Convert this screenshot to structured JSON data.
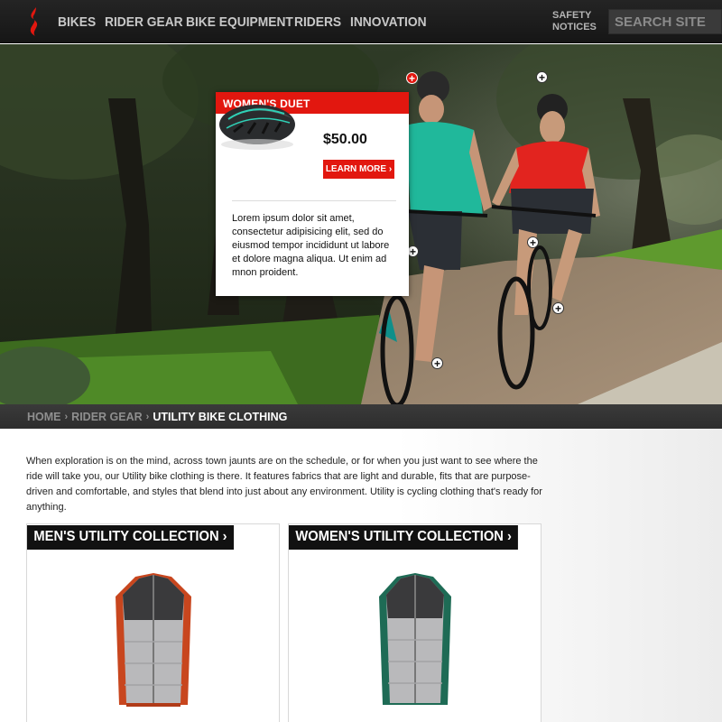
{
  "header": {
    "nav": [
      "BIKES",
      "RIDER GEAR",
      "BIKE EQUIPMENT",
      "RIDERS",
      "INNOVATION"
    ],
    "safety_notices": "SAFETY NOTICES",
    "search_placeholder": "SEARCH SITE",
    "brand_color": "#e2170f"
  },
  "popup": {
    "title": "WOMEN'S DUET",
    "price": "$50.00",
    "button_label": "LEARN MORE ›",
    "description": "Lorem ipsum dolor sit amet, consectetur adipisicing elit, sed do eiusmod tempor incididunt ut labore et dolore magna aliqua. Ut enim ad mnon proident."
  },
  "hotspots": {
    "active_label": "+",
    "label": "+"
  },
  "breadcrumb": {
    "home": "HOME",
    "rider_gear": "RIDER GEAR",
    "current": "UTILITY BIKE CLOTHING",
    "separator": "›"
  },
  "intro_text": "When exploration is on the mind, across town jaunts are on the schedule, or for when you just want to see where the ride will take you, our Utility bike clothing is there. It features fabrics that are light and durable, fits that are purpose-driven and comfortable, and styles that blend into just about any environment. Utility is cycling clothing that's ready for anything.",
  "collections": {
    "men": "MEN'S UTILITY COLLECTION ›",
    "women": "WOMEN'S UTILITY COLLECTION ›"
  }
}
